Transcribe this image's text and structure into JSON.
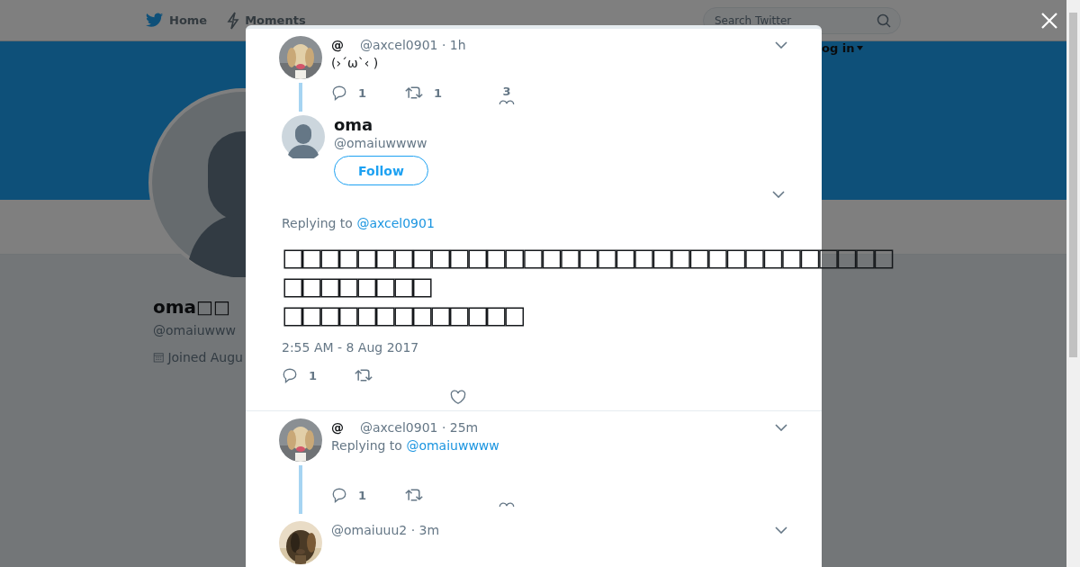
{
  "background_page": {
    "nav": [
      {
        "label": "Home"
      },
      {
        "label": "Moments"
      }
    ],
    "search": {
      "placeholder": "Search Twitter"
    },
    "login": "og in",
    "profile": {
      "name": "oma□□",
      "handle": "@omaiuwww",
      "joined": "Joined Augu"
    }
  },
  "tweets": [
    {
      "kind": "compact",
      "name": "@",
      "meta": "@axcel0901 · 1h",
      "text": "(›´ω`‹ )",
      "replies": "1",
      "retweets": "1",
      "likes": "3",
      "thread_below": true
    },
    {
      "kind": "main",
      "name": "oma",
      "handle": "@omaiuwwww",
      "follow": "Follow",
      "replying_to": "Replying to",
      "reply_handle": "@axcel0901",
      "lines": [
        "□□□□□□□□□□□□□□□□□□□□□□□□□□□□□□□□□",
        "□□□□□□□□",
        "□□□□□□□□□□□□□"
      ],
      "timestamp": "2:55 AM - 8 Aug 2017",
      "replies": "1"
    },
    {
      "kind": "compact",
      "name": "@",
      "meta": "@axcel0901 · 25m",
      "replying_to": "Replying to",
      "reply_handle": "@omaiuwwww",
      "replies": "1",
      "thread_below": true
    },
    {
      "kind": "compact",
      "meta": "@omaiuuu2 · 3m"
    }
  ]
}
